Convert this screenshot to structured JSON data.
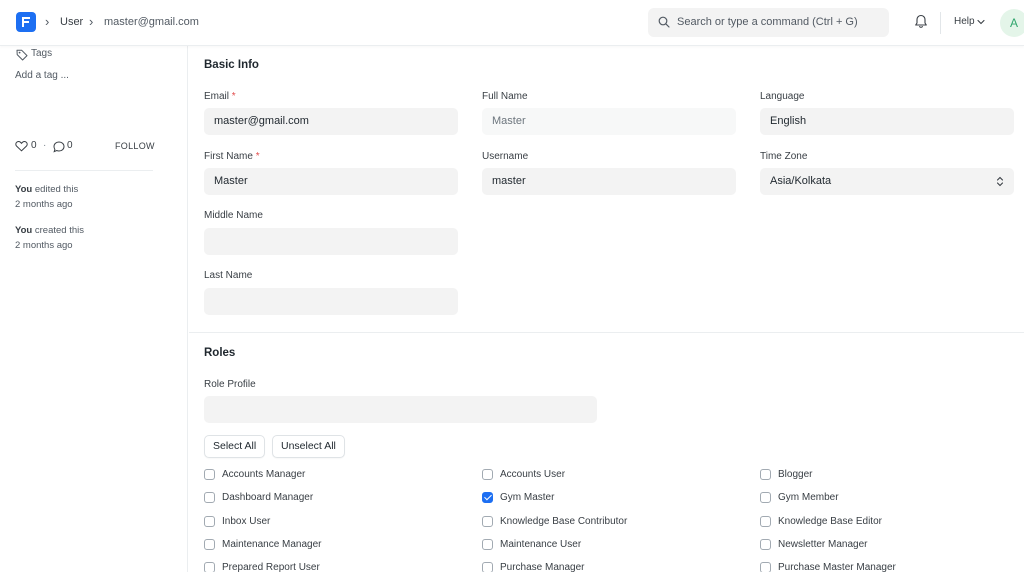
{
  "navbar": {
    "breadcrumb": [
      "User",
      "master@gmail.com"
    ],
    "search_placeholder": "Search or type a command (Ctrl + G)",
    "help_label": "Help",
    "avatar_initial": "A"
  },
  "sidebar": {
    "tags_label": "Tags",
    "add_tag": "Add a tag ...",
    "likes": "0",
    "comments": "0",
    "follow_label": "FOLLOW",
    "activity": [
      {
        "who": "You",
        "what": " edited this",
        "when": "2 months ago"
      },
      {
        "who": "You",
        "what": " created this",
        "when": "2 months ago"
      }
    ]
  },
  "basic_info": {
    "title": "Basic Info",
    "email": {
      "label": "Email",
      "value": "master@gmail.com"
    },
    "full_name": {
      "label": "Full Name",
      "value": "Master"
    },
    "language": {
      "label": "Language",
      "value": "English"
    },
    "first_name": {
      "label": "First Name",
      "value": "Master"
    },
    "username": {
      "label": "Username",
      "value": "master"
    },
    "time_zone": {
      "label": "Time Zone",
      "value": "Asia/Kolkata"
    },
    "middle_name": {
      "label": "Middle Name",
      "value": ""
    },
    "last_name": {
      "label": "Last Name",
      "value": ""
    },
    "required_mark": "*"
  },
  "roles": {
    "title": "Roles",
    "role_profile_label": "Role Profile",
    "role_profile_value": "",
    "select_all": "Select All",
    "unselect_all": "Unselect All",
    "items": [
      {
        "label": "Accounts Manager",
        "checked": false
      },
      {
        "label": "Accounts User",
        "checked": false
      },
      {
        "label": "Blogger",
        "checked": false
      },
      {
        "label": "Dashboard Manager",
        "checked": false
      },
      {
        "label": "Gym Master",
        "checked": true
      },
      {
        "label": "Gym Member",
        "checked": false
      },
      {
        "label": "Inbox User",
        "checked": false
      },
      {
        "label": "Knowledge Base Contributor",
        "checked": false
      },
      {
        "label": "Knowledge Base Editor",
        "checked": false
      },
      {
        "label": "Maintenance Manager",
        "checked": false
      },
      {
        "label": "Maintenance User",
        "checked": false
      },
      {
        "label": "Newsletter Manager",
        "checked": false
      },
      {
        "label": "Prepared Report User",
        "checked": false
      },
      {
        "label": "Purchase Manager",
        "checked": false
      },
      {
        "label": "Purchase Master Manager",
        "checked": false
      }
    ]
  },
  "colors": {
    "brand": "#1d6ff2",
    "checkbox_checked": "#1d6ff2",
    "required": "#e24c4c",
    "avatar_text": "#30a66d"
  }
}
